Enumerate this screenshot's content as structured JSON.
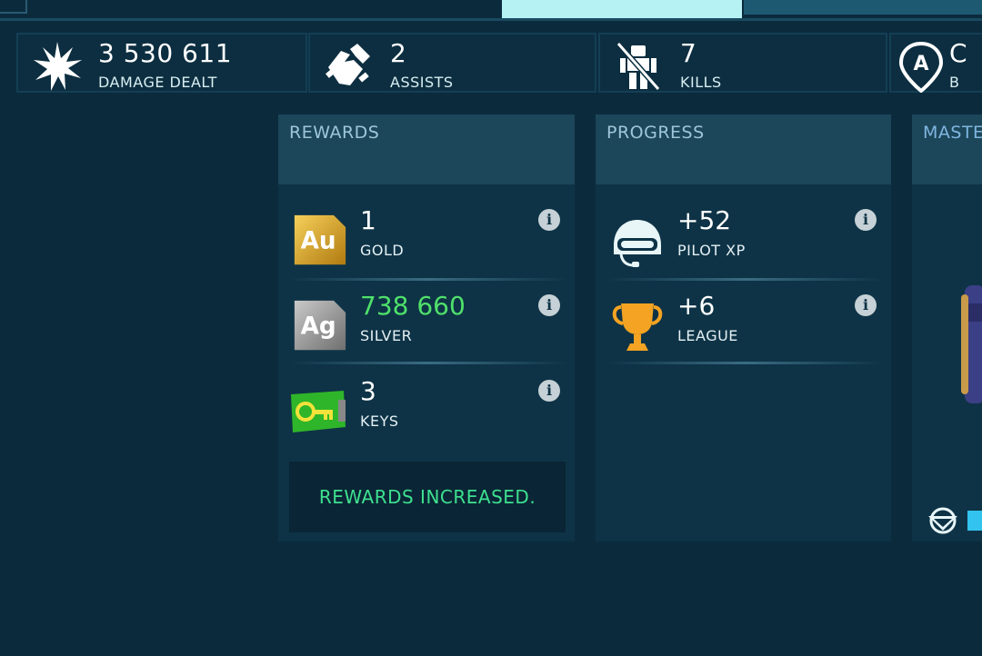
{
  "stats": [
    {
      "value": "3 530 611",
      "label": "DAMAGE DEALT",
      "icon": "explosion-icon"
    },
    {
      "value": "2",
      "label": "ASSISTS",
      "icon": "handshake-icon"
    },
    {
      "value": "7",
      "label": "KILLS",
      "icon": "destroyed-robot-icon"
    },
    {
      "value": "C",
      "label": "B",
      "icon": "beacon-pin-icon"
    }
  ],
  "rewards": {
    "title": "REWARDS",
    "items": [
      {
        "icon_text": "Au",
        "value": "1",
        "label": "GOLD",
        "info": "i"
      },
      {
        "icon_text": "Ag",
        "value": "738 660",
        "label": "SILVER",
        "info": "i"
      },
      {
        "value": "3",
        "label": "KEYS",
        "info": "i"
      }
    ],
    "notice": "REWARDS INCREASED."
  },
  "progress": {
    "title": "PROGRESS",
    "items": [
      {
        "value": "+52",
        "label": "PILOT XP",
        "info": "i"
      },
      {
        "value": "+6",
        "label": "LEAGUE",
        "info": "i"
      }
    ]
  },
  "mastery": {
    "title": "MASTE"
  },
  "colors": {
    "background": "#0b2b3d",
    "panel": "#0e3346",
    "header": "#1c4659",
    "accent_green": "#4fe06a",
    "notice_green": "#3ee08f",
    "tab_active": "#b6f2f4"
  }
}
